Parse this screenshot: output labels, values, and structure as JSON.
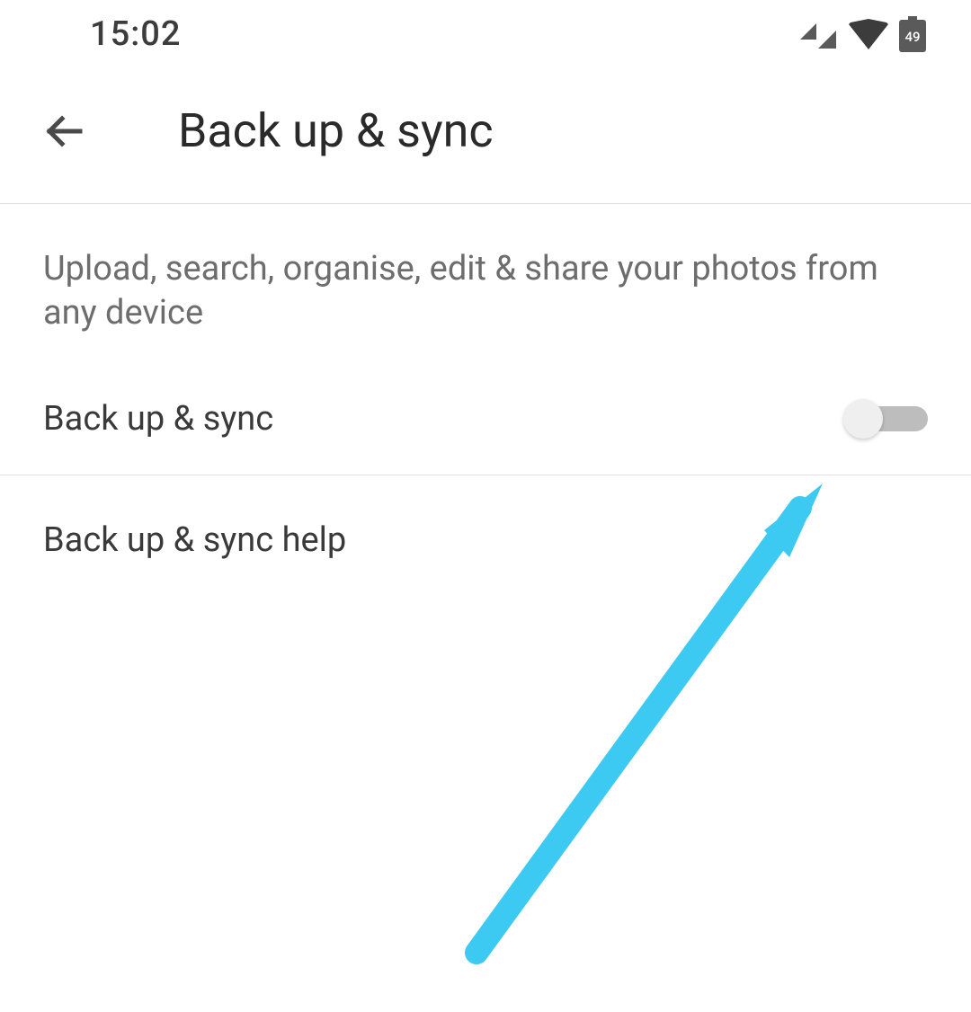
{
  "status": {
    "time": "15:02",
    "battery": "49"
  },
  "header": {
    "title": "Back up & sync"
  },
  "content": {
    "description": "Upload, search, organise, edit & share your photos from any device",
    "backup_toggle_label": "Back up & sync",
    "backup_toggle_state": false,
    "help_label": "Back up & sync help"
  },
  "colors": {
    "annotation": "#3cc9f2"
  }
}
